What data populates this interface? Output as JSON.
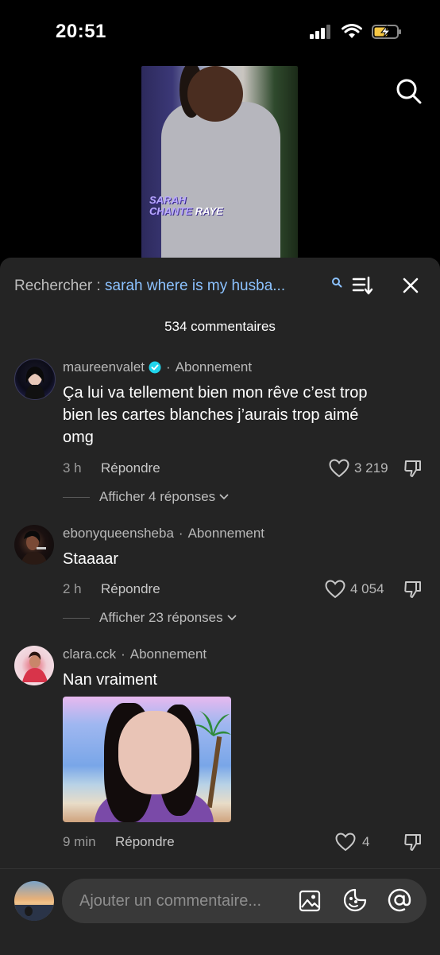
{
  "status_bar": {
    "time": "20:51"
  },
  "video": {
    "caption_line1": "SARAH",
    "caption_line2_a": "CHANTE ",
    "caption_line2_b": "RAYE"
  },
  "comments_panel": {
    "search_label": "Rechercher : ",
    "search_query": "sarah where is my husba...",
    "count_label": "534 commentaires"
  },
  "comments": [
    {
      "username": "maureenvalet",
      "verified": true,
      "follow": "Abonnement",
      "text_lines": [
        "Ça lui va tellement bien mon rêve c’est trop",
        "bien les cartes blanches j’aurais trop aimé",
        "omg"
      ],
      "time": "3 h",
      "reply": "Répondre",
      "likes": "3 219",
      "view_replies": "Afficher 4 réponses"
    },
    {
      "username": "ebonyqueensheba",
      "verified": false,
      "follow": "Abonnement",
      "text_lines": [
        "Staaaar"
      ],
      "time": "2 h",
      "reply": "Répondre",
      "likes": "4 054",
      "view_replies": "Afficher 23 réponses"
    },
    {
      "username": "clara.cck",
      "verified": false,
      "follow": "Abonnement",
      "text_lines": [
        "Nan vraiment"
      ],
      "time": "9 min",
      "reply": "Répondre",
      "likes": "4",
      "has_gif": true
    }
  ],
  "composer": {
    "placeholder": "Ajouter un commentaire..."
  },
  "colors": {
    "query": "#8cc2ff",
    "sheet": "#242424",
    "verified": "#20d5ec"
  }
}
